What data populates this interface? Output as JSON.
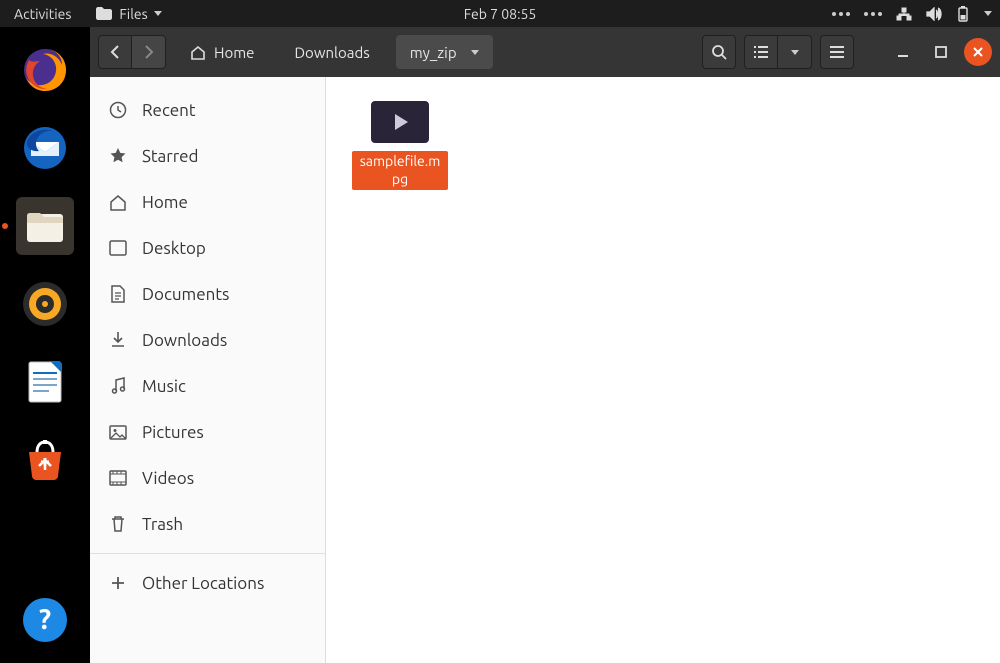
{
  "panel": {
    "activities": "Activities",
    "app_name": "Files",
    "clock": "Feb 7  08:55"
  },
  "dock": {
    "items": [
      "firefox",
      "thunderbird",
      "files",
      "rhythmbox",
      "libreoffice-writer",
      "ubuntu-software",
      "help"
    ]
  },
  "headerbar": {
    "path": [
      {
        "label": "Home",
        "has_home_icon": true
      },
      {
        "label": "Downloads"
      },
      {
        "label": "my_zip",
        "current": true
      }
    ]
  },
  "sidebar": {
    "items": [
      {
        "icon": "clock",
        "label": "Recent"
      },
      {
        "icon": "star",
        "label": "Starred"
      },
      {
        "icon": "home",
        "label": "Home"
      },
      {
        "icon": "desktop",
        "label": "Desktop"
      },
      {
        "icon": "document",
        "label": "Documents"
      },
      {
        "icon": "download",
        "label": "Downloads"
      },
      {
        "icon": "music",
        "label": "Music"
      },
      {
        "icon": "picture",
        "label": "Pictures"
      },
      {
        "icon": "video",
        "label": "Videos"
      },
      {
        "icon": "trash",
        "label": "Trash"
      }
    ],
    "other_label": "Other Locations"
  },
  "files": [
    {
      "name": "samplefile.mpg",
      "type": "video",
      "selected": true
    }
  ]
}
